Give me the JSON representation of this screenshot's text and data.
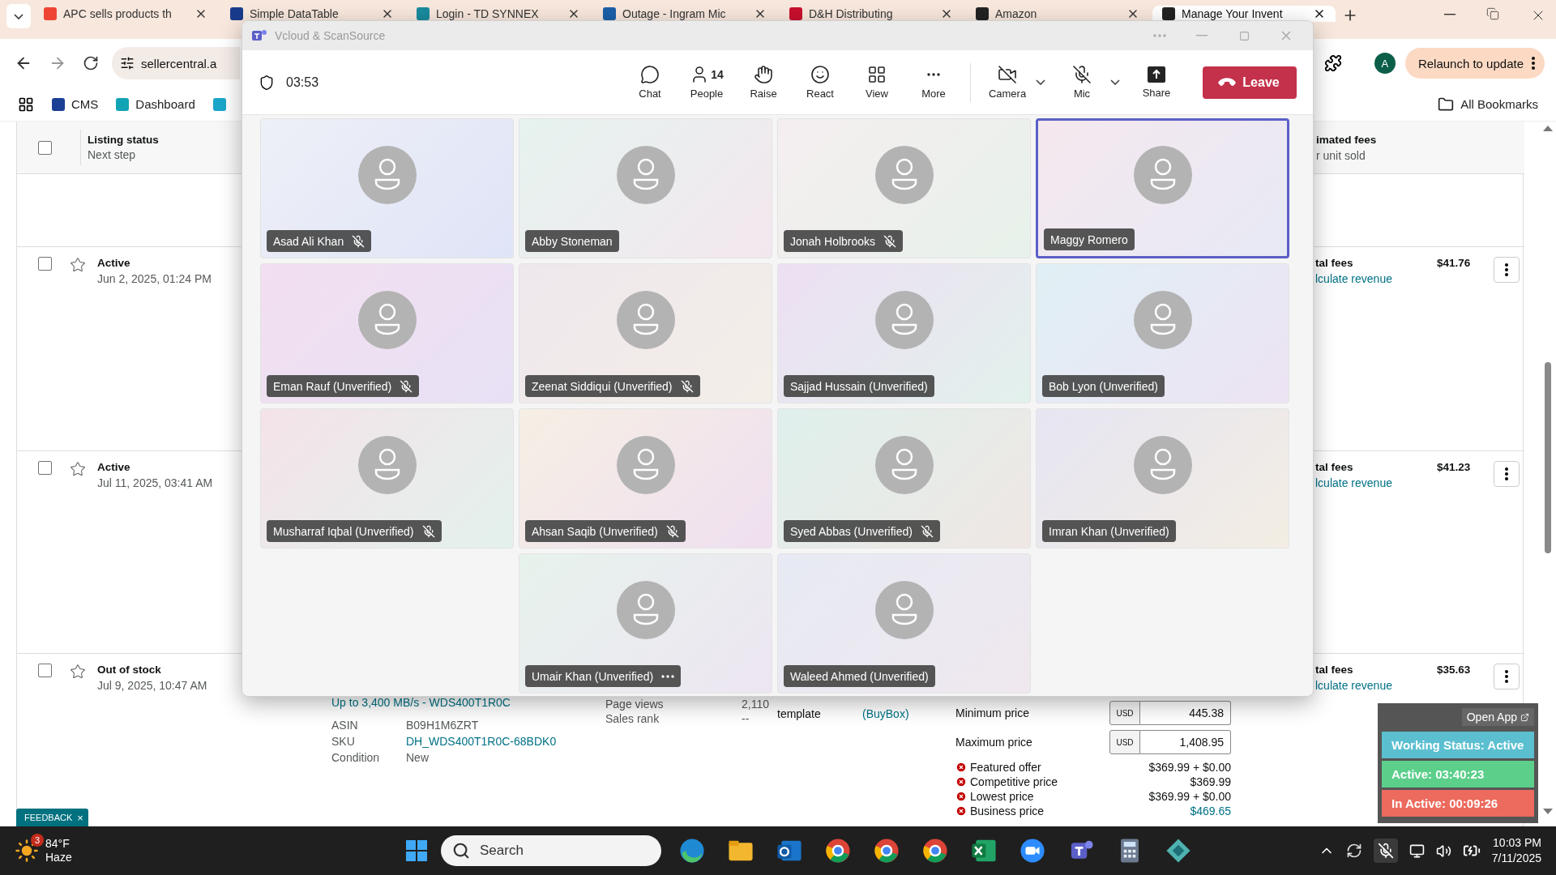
{
  "browser": {
    "tabs": [
      {
        "title": "APC sells products th",
        "selected": false
      },
      {
        "title": "Simple DataTable",
        "selected": false
      },
      {
        "title": "Login - TD SYNNEX",
        "selected": false
      },
      {
        "title": "Outage - Ingram Mic",
        "selected": false
      },
      {
        "title": "D&H Distributing",
        "selected": false
      },
      {
        "title": "Amazon",
        "selected": false
      },
      {
        "title": "Manage Your Invent",
        "selected": true
      }
    ],
    "address": "sellercentral.a",
    "bookmarks": [
      "CMS",
      "Dashboard"
    ],
    "all_bookmarks": "All Bookmarks",
    "profile_initial": "A",
    "relaunch": "Relaunch to update"
  },
  "listing_table": {
    "header": {
      "checked": false,
      "status": "Listing status",
      "next_step": "Next step",
      "fees": "imated fees",
      "fees_sub": "r unit sold"
    },
    "rows": [
      {
        "checked": false,
        "starred": false,
        "status": "Active",
        "date": "Jun 2, 2025, 01:24 PM",
        "fees_label": "tal fees",
        "revenue_link": "lculate revenue",
        "fees": "$41.76"
      },
      {
        "checked": false,
        "starred": false,
        "status": "Active",
        "date": "Jul 11, 2025, 03:41 AM",
        "fees_label": "tal fees",
        "revenue_link": "lculate revenue",
        "fees": "$41.23"
      },
      {
        "checked": false,
        "starred": false,
        "status": "Out of stock",
        "date": "Jul 9, 2025, 10:47 AM",
        "fees_label": "tal fees",
        "revenue_link": "lculate revenue",
        "fees": "$35.63"
      }
    ],
    "product": {
      "title": "Up to 3,400 MB/s - WDS400T1R0C",
      "fields": [
        {
          "label": "ASIN",
          "value": "B09H1M6ZRT",
          "link": false
        },
        {
          "label": "SKU",
          "value": "DH_WDS400T1R0C-68BDK0",
          "link": true
        },
        {
          "label": "Condition",
          "value": "New",
          "link": false
        }
      ],
      "metrics": [
        {
          "label": "Page views",
          "value": "2,110"
        },
        {
          "label": "Sales rank",
          "value": "--"
        }
      ],
      "shipping_label": "template",
      "buybox": "(BuyBox)",
      "price_inputs": [
        {
          "label": "Minimum price",
          "currency": "USD",
          "value": "445.38"
        },
        {
          "label": "Maximum price",
          "currency": "USD",
          "value": "1,408.95"
        }
      ],
      "price_checks": [
        {
          "label": "Featured offer",
          "value": "$369.99 + $0.00",
          "link": false
        },
        {
          "label": "Competitive price",
          "value": "$369.99",
          "link": false
        },
        {
          "label": "Lowest price",
          "value": "$369.99 + $0.00",
          "link": false
        },
        {
          "label": "Business price",
          "value": "$469.65",
          "link": true
        }
      ]
    }
  },
  "feedback": {
    "label": "FEEDBACK",
    "close": "×"
  },
  "time_widget": {
    "open_app": "Open App",
    "statuses": [
      {
        "text": "Working Status: Active",
        "color": "#5bbfd0"
      },
      {
        "text": "Active: 03:40:23",
        "color": "#5ccf8b"
      },
      {
        "text": "In Active: 00:09:26",
        "color": "#ec6b5e"
      }
    ]
  },
  "meeting": {
    "title": "Vcloud & ScanSource",
    "timer": "03:53",
    "controls": [
      {
        "kind": "chat",
        "label": "Chat"
      },
      {
        "kind": "people",
        "label": "People",
        "count": "14"
      },
      {
        "kind": "raise",
        "label": "Raise"
      },
      {
        "kind": "react",
        "label": "React"
      },
      {
        "kind": "view",
        "label": "View"
      },
      {
        "kind": "more",
        "label": "More"
      },
      {
        "kind": "camera",
        "label": "Camera",
        "on": false,
        "dropdown": true
      },
      {
        "kind": "mic",
        "label": "Mic",
        "on": false,
        "dropdown": true
      },
      {
        "kind": "share",
        "label": "Share"
      }
    ],
    "leave": "Leave",
    "participants": [
      {
        "name": "Asad Ali Khan",
        "muted": true,
        "speaking": false,
        "menu": false
      },
      {
        "name": "Abby Stoneman",
        "muted": false,
        "speaking": false,
        "menu": false
      },
      {
        "name": "Jonah Holbrooks",
        "muted": true,
        "speaking": false,
        "menu": false
      },
      {
        "name": "Maggy Romero",
        "muted": false,
        "speaking": true,
        "menu": false
      },
      {
        "name": "Eman Rauf (Unverified)",
        "muted": true,
        "speaking": false,
        "menu": false
      },
      {
        "name": "Zeenat Siddiqui (Unverified)",
        "muted": true,
        "speaking": false,
        "menu": false
      },
      {
        "name": "Sajjad Hussain (Unverified)",
        "muted": false,
        "speaking": false,
        "menu": false
      },
      {
        "name": "Bob Lyon (Unverified)",
        "muted": false,
        "speaking": false,
        "menu": false
      },
      {
        "name": "Musharraf Iqbal (Unverified)",
        "muted": true,
        "speaking": false,
        "menu": false
      },
      {
        "name": "Ahsan Saqib (Unverified)",
        "muted": true,
        "speaking": false,
        "menu": false
      },
      {
        "name": "Syed Abbas (Unverified)",
        "muted": true,
        "speaking": false,
        "menu": false
      },
      {
        "name": "Imran Khan (Unverified)",
        "muted": false,
        "speaking": false,
        "menu": false
      },
      {
        "name": "Umair Khan (Unverified)",
        "muted": false,
        "speaking": false,
        "menu": true
      },
      {
        "name": "Waleed Ahmed (Unverified)",
        "muted": false,
        "speaking": false,
        "menu": false
      }
    ]
  },
  "taskbar": {
    "weather": {
      "temp": "84°F",
      "condition": "Haze",
      "badge": "3"
    },
    "search_placeholder": "Search",
    "clock": {
      "time": "10:03 PM",
      "date": "7/11/2025"
    }
  }
}
